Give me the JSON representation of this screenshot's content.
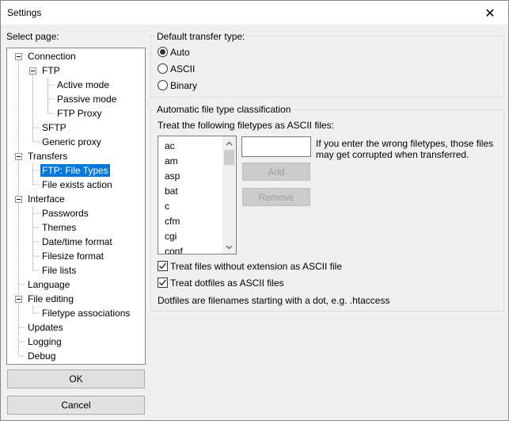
{
  "window": {
    "title": "Settings",
    "close_symbol": "✕"
  },
  "select_page_label": "Select page:",
  "tree": {
    "items": [
      {
        "label": "Connection"
      },
      {
        "label": "FTP"
      },
      {
        "label": "Active mode"
      },
      {
        "label": "Passive mode"
      },
      {
        "label": "FTP Proxy"
      },
      {
        "label": "SFTP"
      },
      {
        "label": "Generic proxy"
      },
      {
        "label": "Transfers"
      },
      {
        "label": "FTP: File Types",
        "selected": true
      },
      {
        "label": "File exists action"
      },
      {
        "label": "Interface"
      },
      {
        "label": "Passwords"
      },
      {
        "label": "Themes"
      },
      {
        "label": "Date/time format"
      },
      {
        "label": "Filesize format"
      },
      {
        "label": "File lists"
      },
      {
        "label": "Language"
      },
      {
        "label": "File editing"
      },
      {
        "label": "Filetype associations"
      },
      {
        "label": "Updates"
      },
      {
        "label": "Logging"
      },
      {
        "label": "Debug"
      }
    ]
  },
  "buttons": {
    "ok": "OK",
    "cancel": "Cancel"
  },
  "transfer_type": {
    "title": "Default transfer type:",
    "options": [
      "Auto",
      "ASCII",
      "Binary"
    ],
    "selected": "Auto"
  },
  "classification": {
    "title": "Automatic file type classification",
    "treat_label": "Treat the following filetypes as ASCII files:",
    "filetypes": [
      "ac",
      "am",
      "asp",
      "bat",
      "c",
      "cfm",
      "cgi",
      "conf"
    ],
    "new_filetype_value": "",
    "warning_line1": "If you enter the wrong filetypes, those files",
    "warning_line2": "may get corrupted when transferred.",
    "add_label": "Add",
    "remove_label": "Remove",
    "checkbox_no_extension": {
      "label": "Treat files without extension as ASCII file",
      "checked": true
    },
    "checkbox_dotfiles": {
      "label": "Treat dotfiles as ASCII files",
      "checked": true
    },
    "dotfiles_note": "Dotfiles are filenames starting with a dot, e.g. .htaccess"
  },
  "icons": {
    "expander": "collapse-icon",
    "checkmark": "checkmark-icon",
    "scroll_up": "scroll-up-icon",
    "scroll_down": "scroll-down-icon"
  },
  "colors": {
    "selection": "#0078d7",
    "background": "#f0f0f0"
  }
}
